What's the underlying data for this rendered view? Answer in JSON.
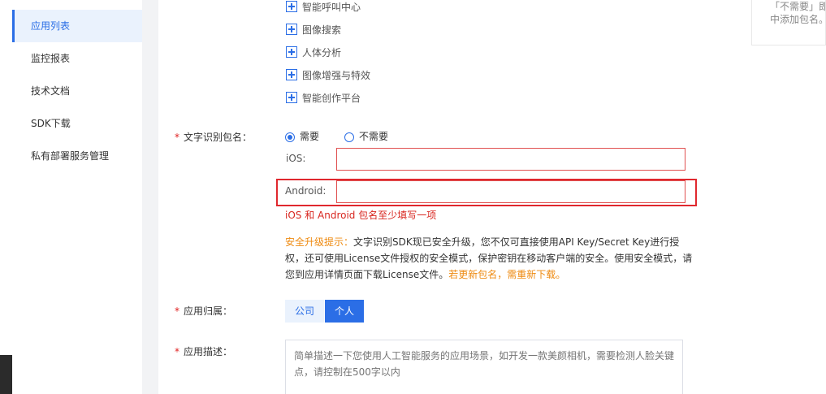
{
  "sidebar": {
    "items": [
      {
        "label": "应用列表"
      },
      {
        "label": "监控报表"
      },
      {
        "label": "技术文档"
      },
      {
        "label": "SDK下载"
      },
      {
        "label": "私有部署服务管理"
      }
    ],
    "active_index": 0
  },
  "tree": {
    "items": [
      {
        "label": "智能呼叫中心"
      },
      {
        "label": "图像搜索"
      },
      {
        "label": "人体分析"
      },
      {
        "label": "图像增强与特效"
      },
      {
        "label": "智能创作平台"
      }
    ]
  },
  "ocr_package": {
    "label": "文字识别包名：",
    "options": [
      {
        "label": "需要",
        "checked": true
      },
      {
        "label": "不需要",
        "checked": false
      }
    ],
    "ios_label": "iOS:",
    "ios_value": "",
    "android_label": "Android:",
    "android_value": "",
    "error": "iOS 和 Android 包名至少填写一项"
  },
  "notice": {
    "title": "安全升级提示：",
    "body": "文字识别SDK现已安全升级，您不仅可直接使用API Key/Secret Key进行授权，还可使用License文件授权的安全模式，保护密钥在移动客户端的安全。使用安全模式，请您到应用详情页面下载License文件。",
    "tail": "若更新包名，需重新下载。"
  },
  "ownership": {
    "label": "应用归属：",
    "options": [
      {
        "label": "公司",
        "selected": false
      },
      {
        "label": "个人",
        "selected": true
      }
    ]
  },
  "description": {
    "label": "应用描述：",
    "placeholder": "简单描述一下您使用人工智能服务的应用场景，如开发一款美颜相机，需要检测人脸关键点，请控制在500字以内"
  },
  "right_hint": {
    "line1": "「不需要」即",
    "line2": "中添加包名。"
  },
  "colors": {
    "accent": "#2b6ee6",
    "error": "#d8261f",
    "warning": "#ee8a10",
    "highlight": "#e0282e"
  }
}
